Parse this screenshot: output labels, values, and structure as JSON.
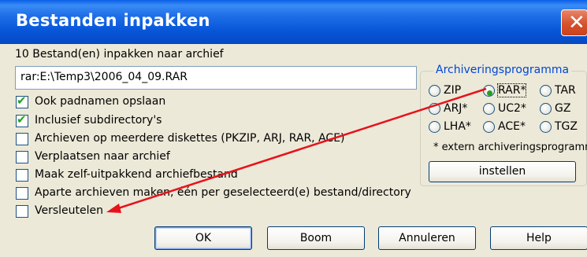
{
  "window": {
    "title": "Bestanden inpakken",
    "close_glyph": "✕",
    "close_icon": "close-icon"
  },
  "archive": {
    "label": "10 Bestand(en) inpakken naar archief",
    "path": "rar:E:\\Temp3\\2006_04_09.RAR"
  },
  "options": [
    {
      "label": "Ook padnamen opslaan",
      "checked": true
    },
    {
      "label": "Inclusief subdirectory's",
      "checked": true
    },
    {
      "label": "Archieven op meerdere diskettes (PKZIP, ARJ, RAR, ACE)",
      "checked": false
    },
    {
      "label": "Verplaatsen naar archief",
      "checked": false
    },
    {
      "label": "Maak zelf-uitpakkend archiefbestand",
      "checked": false
    },
    {
      "label": "Aparte archieven maken, één per geselecteerd(e) bestand/directory",
      "checked": false
    },
    {
      "label": "Versleutelen",
      "checked": false
    }
  ],
  "packer": {
    "title": "Archiveringsprogramma",
    "options": [
      {
        "label": "ZIP",
        "selected": false
      },
      {
        "label": "RAR*",
        "selected": true
      },
      {
        "label": "TAR",
        "selected": false
      },
      {
        "label": "ARJ*",
        "selected": false
      },
      {
        "label": "UC2*",
        "selected": false
      },
      {
        "label": "GZ",
        "selected": false
      },
      {
        "label": "LHA*",
        "selected": false
      },
      {
        "label": "ACE*",
        "selected": false
      },
      {
        "label": "TGZ",
        "selected": false
      }
    ],
    "note": "* extern archiveringsprogramma",
    "setup_label": "instellen"
  },
  "buttons": {
    "ok": "OK",
    "tree": "Boom",
    "cancel": "Annuleren",
    "help": "Help"
  },
  "annotation": {
    "arrow_color": "#e8121b"
  }
}
